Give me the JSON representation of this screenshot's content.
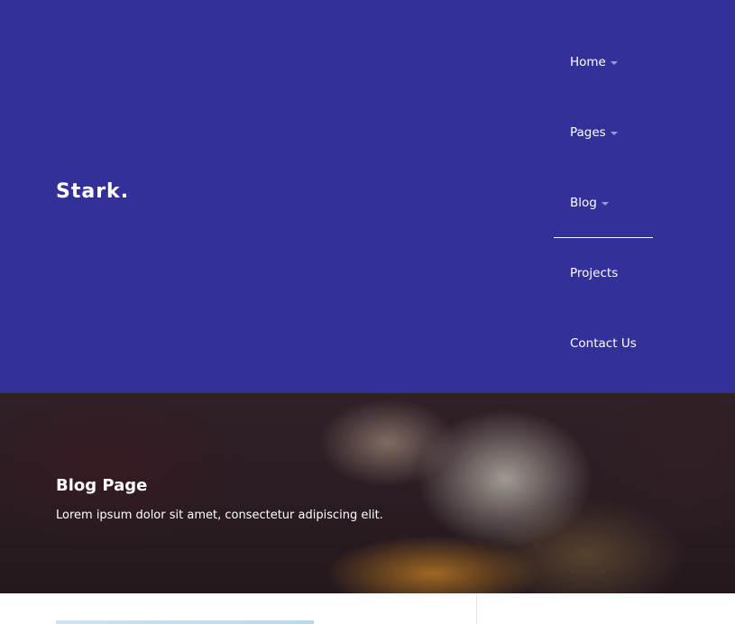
{
  "brand": {
    "logo": "Stark."
  },
  "nav": {
    "items": [
      {
        "label": "Home",
        "dropdown": true
      },
      {
        "label": "Pages",
        "dropdown": true
      },
      {
        "label": "Blog",
        "dropdown": true,
        "active": true
      },
      {
        "label": "Projects",
        "dropdown": false
      },
      {
        "label": "Contact Us",
        "dropdown": false
      }
    ]
  },
  "hero": {
    "title": "Blog Page",
    "subtitle": "Lorem ipsum dolor sit amet, consectetur adipiscing elit."
  },
  "colors": {
    "header_bg": "#33309a",
    "nav_text": "#ffffff",
    "caret": "#9a9ad6"
  }
}
